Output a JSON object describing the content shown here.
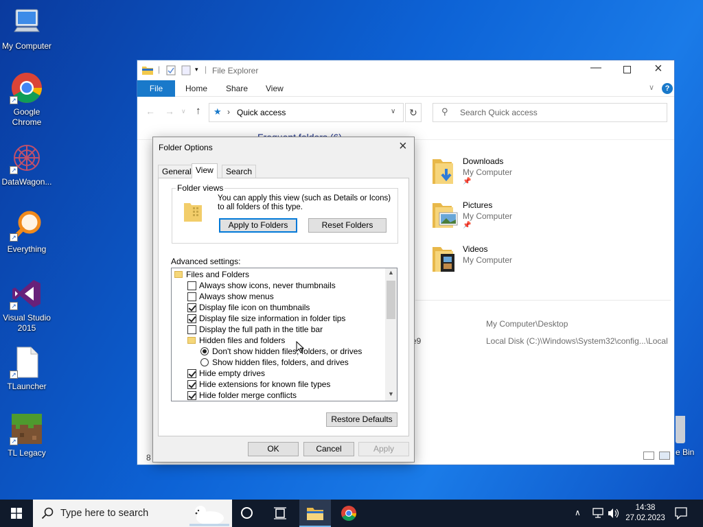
{
  "desktop": {
    "icons": [
      {
        "label": "My Computer"
      },
      {
        "label": "Google Chrome"
      },
      {
        "label": "DataWagon..."
      },
      {
        "label": "Everything"
      },
      {
        "label": "Visual Studio 2015"
      },
      {
        "label": "TLauncher"
      },
      {
        "label": "TL Legacy"
      }
    ],
    "partial_recycle": "e Bin"
  },
  "explorer": {
    "title": "File Explorer",
    "ribbon_tabs": [
      "File",
      "Home",
      "Share",
      "View"
    ],
    "address": "Quick access",
    "search_placeholder": "Search Quick access",
    "frequent_header": "Frequent folders (6)",
    "folders": [
      {
        "name": "Downloads",
        "location": "My Computer"
      },
      {
        "name": "Pictures",
        "location": "My Computer"
      },
      {
        "name": "Videos",
        "location": "My Computer"
      }
    ],
    "recent_paths": [
      "My Computer\\Desktop",
      "Local Disk (C:)\\Windows\\System32\\config...\\Local"
    ],
    "recent_fragment": "e9",
    "status_count": "8"
  },
  "dialog": {
    "title": "Folder Options",
    "tabs": [
      "General",
      "View",
      "Search"
    ],
    "folder_views_label": "Folder views",
    "folder_views_text": "You can apply this view (such as Details or Icons) to all folders of this type.",
    "apply_to_folders": "Apply to Folders",
    "reset_folders": "Reset Folders",
    "advanced_label": "Advanced settings:",
    "advanced_items": [
      {
        "text": "Files and Folders",
        "kind": "folder",
        "indent": 0
      },
      {
        "text": "Always show icons, never thumbnails",
        "kind": "checkbox",
        "checked": false,
        "indent": 1
      },
      {
        "text": "Always show menus",
        "kind": "checkbox",
        "checked": false,
        "indent": 1
      },
      {
        "text": "Display file icon on thumbnails",
        "kind": "checkbox",
        "checked": true,
        "indent": 1
      },
      {
        "text": "Display file size information in folder tips",
        "kind": "checkbox",
        "checked": true,
        "indent": 1
      },
      {
        "text": "Display the full path in the title bar",
        "kind": "checkbox",
        "checked": false,
        "indent": 1
      },
      {
        "text": "Hidden files and folders",
        "kind": "folder",
        "indent": 1
      },
      {
        "text": "Don't show hidden files, folders, or drives",
        "kind": "radio",
        "checked": true,
        "indent": 2
      },
      {
        "text": "Show hidden files, folders, and drives",
        "kind": "radio",
        "checked": false,
        "indent": 2
      },
      {
        "text": "Hide empty drives",
        "kind": "checkbox",
        "checked": true,
        "indent": 1
      },
      {
        "text": "Hide extensions for known file types",
        "kind": "checkbox",
        "checked": true,
        "indent": 1
      },
      {
        "text": "Hide folder merge conflicts",
        "kind": "checkbox",
        "checked": true,
        "indent": 1
      }
    ],
    "restore_defaults": "Restore Defaults",
    "ok": "OK",
    "cancel": "Cancel",
    "apply": "Apply"
  },
  "taskbar": {
    "search_placeholder": "Type here to search",
    "time": "14:38",
    "date": "27.02.2023"
  },
  "colors": {
    "accent": "#0078d7",
    "file_tab": "#1979ca",
    "taskbar": "#101a2b"
  }
}
